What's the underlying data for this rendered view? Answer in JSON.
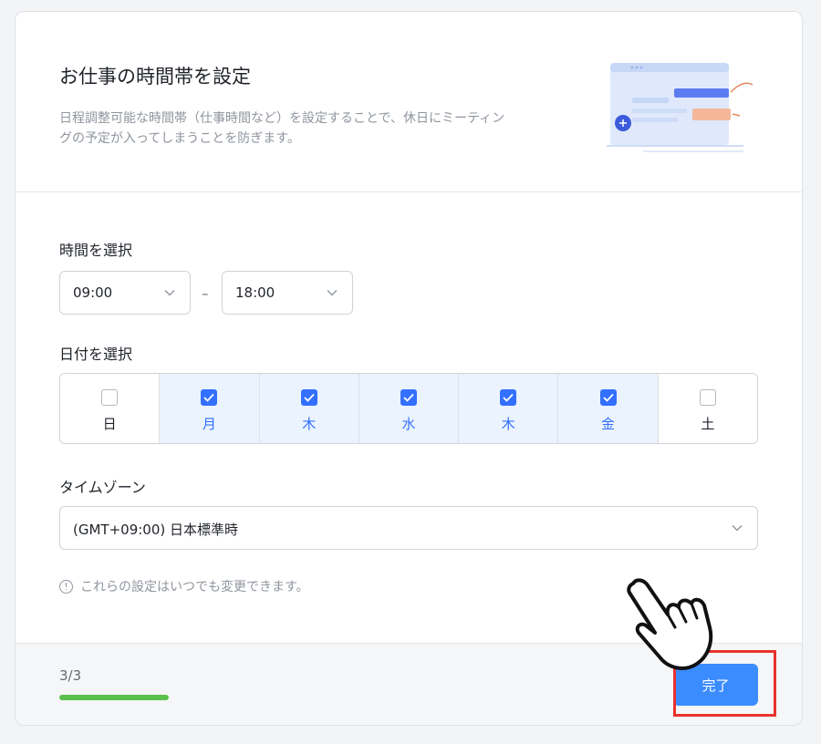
{
  "header": {
    "title": "お仕事の時間帯を設定",
    "description": "日程調整可能な時間帯（仕事時間など）を設定することで、休日にミーティングの予定が入ってしまうことを防ぎます。"
  },
  "time": {
    "label": "時間を選択",
    "start": "09:00",
    "separator": "–",
    "end": "18:00"
  },
  "days": {
    "label": "日付を選択",
    "items": [
      {
        "label": "日",
        "checked": false
      },
      {
        "label": "月",
        "checked": true
      },
      {
        "label": "木",
        "checked": true
      },
      {
        "label": "水",
        "checked": true
      },
      {
        "label": "木",
        "checked": true
      },
      {
        "label": "金",
        "checked": true
      },
      {
        "label": "土",
        "checked": false
      }
    ]
  },
  "timezone": {
    "label": "タイムゾーン",
    "value": "(GMT+09:00) 日本標準時"
  },
  "note": "これらの設定はいつでも変更できます。",
  "footer": {
    "step": "3/3",
    "progress": 1.0,
    "done_label": "完了"
  },
  "colors": {
    "accent": "#3370ff",
    "button": "#3b8cff",
    "progress": "#59c04c",
    "highlight": "#e8322c",
    "selected_bg": "#ebf3fe"
  }
}
